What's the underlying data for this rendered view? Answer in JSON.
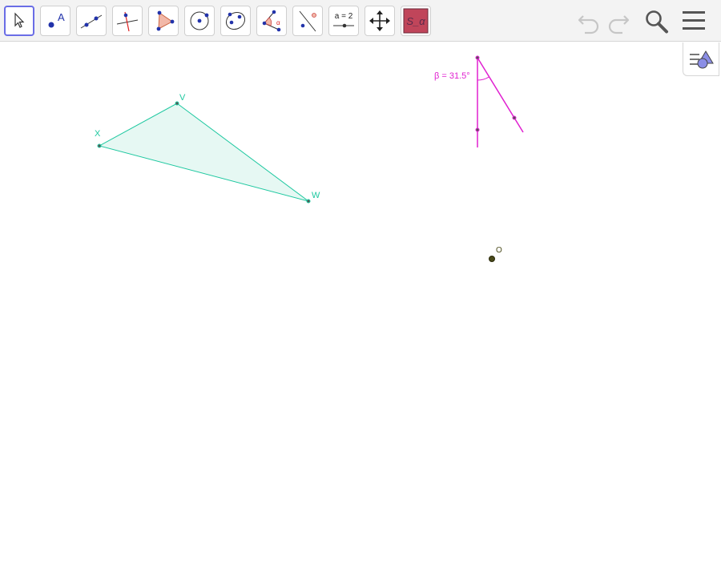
{
  "toolbar": {
    "tools": [
      {
        "id": "move",
        "icon": "move-arrow-icon",
        "selected": true
      },
      {
        "id": "point",
        "icon": "point-icon",
        "label": "A"
      },
      {
        "id": "line",
        "icon": "line-through-points-icon"
      },
      {
        "id": "perpendicular",
        "icon": "perpendicular-line-icon"
      },
      {
        "id": "polygon",
        "icon": "polygon-icon"
      },
      {
        "id": "circle",
        "icon": "circle-center-point-icon"
      },
      {
        "id": "conic",
        "icon": "ellipse-icon"
      },
      {
        "id": "angle",
        "icon": "angle-icon"
      },
      {
        "id": "reflect",
        "icon": "reflect-about-line-icon"
      },
      {
        "id": "slider",
        "icon": "slider-icon",
        "label": "a = 2"
      },
      {
        "id": "move-view",
        "icon": "move-graphics-view-icon"
      },
      {
        "id": "custom-tool",
        "icon": "custom-tool-icon",
        "label": "S_α"
      }
    ],
    "right": [
      "undo-icon",
      "redo-icon",
      "search-icon",
      "menu-icon"
    ]
  },
  "canvas": {
    "triangle": {
      "vertices": [
        "V",
        "W",
        "X"
      ],
      "fill": "#e6f8f3",
      "stroke": "#1ec8a0"
    },
    "angle": {
      "label": "β = 31.5°",
      "value_degrees": 31.5,
      "color": "#e020d0"
    },
    "point_o": {
      "label": "O",
      "color": "#4a4a1a"
    }
  },
  "colors": {
    "accent": "#6a6de6",
    "tool_blue": "#2233aa",
    "custom_tool_bg": "#c0455a"
  }
}
